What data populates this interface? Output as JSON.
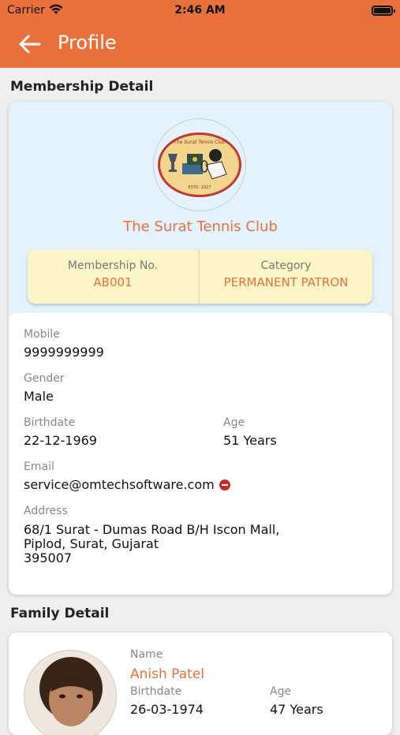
{
  "status": {
    "carrier": "Carrier",
    "time": "2:46 AM"
  },
  "nav": {
    "title": "Profile"
  },
  "membership": {
    "section_title": "Membership Detail",
    "logo": {
      "top_text": "The Surat Tennis Club",
      "bottom_text": "ESTD. 1927"
    },
    "club_name": "The Surat Tennis Club",
    "membership_no_label": "Membership No.",
    "membership_no": "AB001",
    "category_label": "Category",
    "category": "PERMANENT PATRON",
    "fields": {
      "mobile_label": "Mobile",
      "mobile": "9999999999",
      "gender_label": "Gender",
      "gender": "Male",
      "birthdate_label": "Birthdate",
      "birthdate": "22-12-1969",
      "age_label": "Age",
      "age": "51 Years",
      "email_label": "Email",
      "email": "service@omtechsoftware.com",
      "address_label": "Address",
      "address_line1": "68/1 Surat - Dumas Road B/H Iscon Mall,",
      "address_line2": "Piplod, Surat, Gujarat",
      "address_line3": "395007"
    }
  },
  "family": {
    "section_title": "Family Detail",
    "name_label": "Name",
    "name": "Anish Patel",
    "birthdate_label": "Birthdate",
    "birthdate": "26-03-1974",
    "age_label": "Age",
    "age": "47 Years"
  },
  "colors": {
    "accent": "#e8703a",
    "card_top": "#e3f2fd",
    "badge": "#fdf5c8",
    "remove": "#cc2b2b"
  }
}
